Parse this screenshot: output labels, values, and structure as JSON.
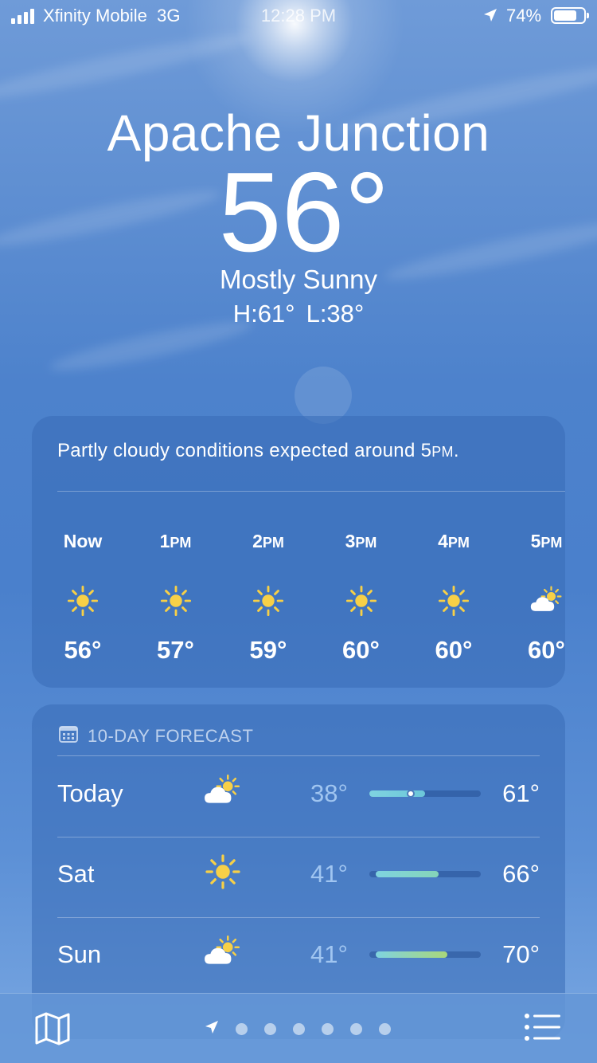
{
  "status_bar": {
    "carrier": "Xfinity Mobile",
    "network": "3G",
    "time": "12:28 PM",
    "battery": "74%",
    "battery_level": 0.74,
    "signal_bars": 4,
    "icons": [
      "signal-icon",
      "location-arrow-icon",
      "battery-icon"
    ]
  },
  "current": {
    "city": "Apache Junction",
    "temperature": "56°",
    "condition": "Mostly Sunny",
    "high": "H:61°",
    "low": "L:38°"
  },
  "hourly": {
    "summary_before": "Partly cloudy conditions expected around 5",
    "summary_pm": "PM",
    "summary_after": ".",
    "hours": [
      {
        "label": "Now",
        "suffix": "",
        "icon": "sun-icon",
        "temp": "56°"
      },
      {
        "label": "1",
        "suffix": "PM",
        "icon": "sun-icon",
        "temp": "57°"
      },
      {
        "label": "2",
        "suffix": "PM",
        "icon": "sun-icon",
        "temp": "59°"
      },
      {
        "label": "3",
        "suffix": "PM",
        "icon": "sun-icon",
        "temp": "60°"
      },
      {
        "label": "4",
        "suffix": "PM",
        "icon": "sun-icon",
        "temp": "60°"
      },
      {
        "label": "5",
        "suffix": "PM",
        "icon": "partly-cloudy-icon",
        "temp": "60°"
      }
    ]
  },
  "forecast": {
    "header": "10-DAY FORECAST",
    "header_icon": "calendar-icon",
    "days": [
      {
        "day": "Today",
        "icon": "partly-cloudy-icon",
        "low": "38°",
        "high": "61°",
        "range_start": 0.0,
        "range_end": 0.5,
        "current_marker": 0.37,
        "gradient": [
          "#7fd3e0",
          "#6cc7d9"
        ]
      },
      {
        "day": "Sat",
        "icon": "sun-icon",
        "low": "41°",
        "high": "66°",
        "range_start": 0.06,
        "range_end": 0.62,
        "gradient": [
          "#7fd3e0",
          "#85d4b8"
        ]
      },
      {
        "day": "Sun",
        "icon": "partly-cloudy-icon",
        "low": "41°",
        "high": "70°",
        "range_start": 0.06,
        "range_end": 0.7,
        "gradient": [
          "#7fd3e0",
          "#a9d77a"
        ]
      }
    ]
  },
  "toolbar": {
    "map_icon": "map-icon",
    "location_icon": "location-arrow-icon",
    "page_count": 6,
    "list_icon": "list-icon"
  }
}
